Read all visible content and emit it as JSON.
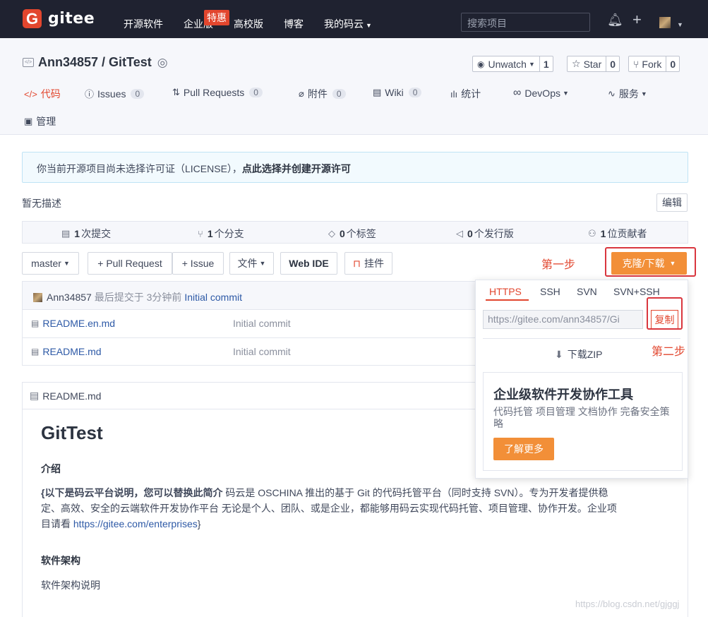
{
  "nav": {
    "logo_letter": "G",
    "logo_text": "gitee",
    "items": [
      "开源软件",
      "企业版",
      "高校版",
      "博客",
      "我的码云"
    ],
    "hot_badge": "特惠",
    "search_placeholder": "搜索项目"
  },
  "repo": {
    "title": "Ann34857 / GitTest",
    "watch_label": "Unwatch",
    "watch_count": "1",
    "star_label": "Star",
    "star_count": "0",
    "fork_label": "Fork",
    "fork_count": "0"
  },
  "tabs": [
    {
      "label": "代码"
    },
    {
      "label": "Issues",
      "count": "0"
    },
    {
      "label": "Pull Requests",
      "count": "0"
    },
    {
      "label": "附件",
      "count": "0"
    },
    {
      "label": "Wiki",
      "count": "0"
    },
    {
      "label": "统计"
    },
    {
      "label": "DevOps"
    },
    {
      "label": "服务"
    },
    {
      "label": "管理"
    }
  ],
  "license": {
    "text": "你当前开源项目尚未选择许可证（LICENSE），",
    "link": "点此选择并创建开源许可"
  },
  "description": "暂无描述",
  "edit_label": "编辑",
  "stats": [
    {
      "num": "1",
      "label": "次提交"
    },
    {
      "num": "1",
      "label": "个分支"
    },
    {
      "num": "0",
      "label": "个标签"
    },
    {
      "num": "0",
      "label": "个发行版"
    },
    {
      "num": "1",
      "label": "位贡献者"
    }
  ],
  "toolbar": {
    "branch": "master",
    "pull_request": "+ Pull Request",
    "issue": "+ Issue",
    "file": "文件",
    "web_ide": "Web IDE",
    "widget": "挂件",
    "clone": "克隆/下载"
  },
  "annotations": {
    "step1": "第一步",
    "step2": "第二步"
  },
  "commit": {
    "author": "Ann34857",
    "meta": "最后提交于 3分钟前",
    "message": "Initial commit"
  },
  "files": [
    {
      "name": "README.en.md",
      "message": "Initial commit"
    },
    {
      "name": "README.md",
      "message": "Initial commit"
    }
  ],
  "readme": {
    "filename": "README.md",
    "h1": "GitTest",
    "intro_heading": "介绍",
    "intro_bold": "{以下是码云平台说明，您可以替换此简介",
    "intro_line1": " 码云是 OSCHINA 推出的基于 Git 的代码托管平台（同时支持 SVN）。专为开发者提供稳",
    "intro_line2": "定、高效、安全的云端软件开发协作平台 无论是个人、团队、或是企业，都能够用码云实现代码托管、项目管理、协作开发。企业项",
    "intro_line3_pre": "目请看 ",
    "intro_link": "https://gitee.com/enterprises",
    "intro_line3_post": "}",
    "arch_heading": "软件架构",
    "arch_text": "软件架构说明"
  },
  "clone_dropdown": {
    "tabs": [
      "HTTPS",
      "SSH",
      "SVN",
      "SVN+SSH"
    ],
    "url": "https://gitee.com/ann34857/Gi",
    "copy_label": "复制",
    "zip_label": "下载ZIP",
    "promo_title": "企业级软件开发协作工具",
    "promo_text": "代码托管 项目管理 文档协作 完备安全策略",
    "promo_button": "了解更多"
  },
  "watermark": "https://blog.csdn.net/gjggj"
}
